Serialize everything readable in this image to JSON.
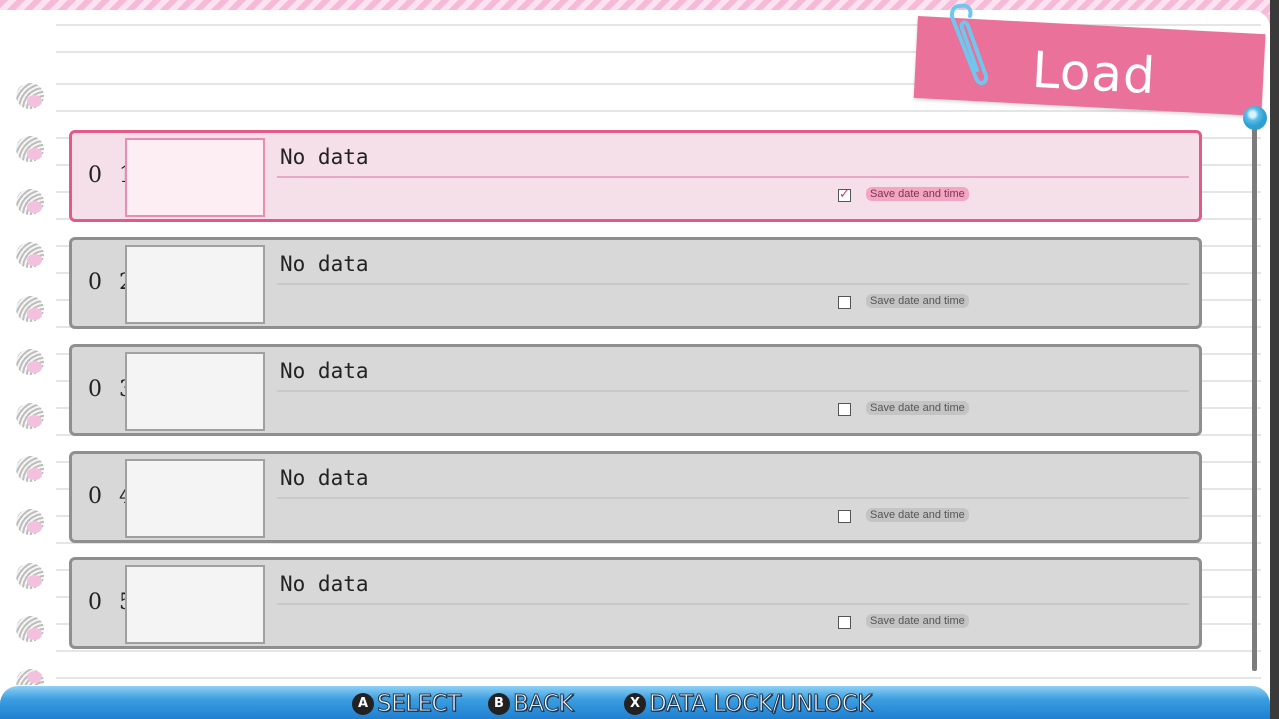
{
  "screen": {
    "title": "Load"
  },
  "slots": [
    {
      "number": "01",
      "title": "No data",
      "date_label": "Save date and time",
      "locked": true
    },
    {
      "number": "02",
      "title": "No data",
      "date_label": "Save date and time",
      "locked": false
    },
    {
      "number": "03",
      "title": "No data",
      "date_label": "Save date and time",
      "locked": false
    },
    {
      "number": "04",
      "title": "No data",
      "date_label": "Save date and time",
      "locked": false
    },
    {
      "number": "05",
      "title": "No data",
      "date_label": "Save date and time",
      "locked": false
    }
  ],
  "selected_slot": "01",
  "controls": {
    "select": {
      "button": "A",
      "label": "SELECT"
    },
    "back": {
      "button": "B",
      "label": "BACK"
    },
    "lock": {
      "button": "X",
      "label": "DATA LOCK/UNLOCK"
    }
  },
  "colors": {
    "selected_border": "#e25a88",
    "tag": "#ea7199",
    "bar": "#1f7fd1"
  },
  "icons": [
    "paperclip-icon",
    "spiral-ring-icon",
    "checkbox-icon",
    "scroll-knob-icon"
  ]
}
